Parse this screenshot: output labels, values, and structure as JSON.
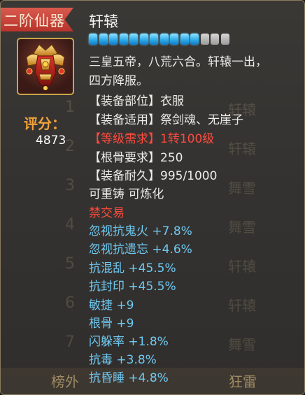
{
  "header": {
    "rank_tag": "二阶仙器",
    "item_name": "轩辕"
  },
  "gems": {
    "filled": 11,
    "total": 14
  },
  "icon": {
    "name": "armor-icon"
  },
  "score": {
    "label": "评分：",
    "value": "4873"
  },
  "details": {
    "desc_1": "三皇五帝，八荒六合。轩辕一出，",
    "desc_2": "四方降服。",
    "slot": "【装备部位】衣服",
    "applicable": "【装备适用】祭剑魂、无崖子",
    "level_req": "【等级需求】1转100级",
    "bone_req": "【根骨要求】250",
    "durability": "【装备耐久】995/1000",
    "flags": "可重铸 可炼化",
    "no_trade": "禁交易"
  },
  "attributes": [
    "忽视抗鬼火 +7.8%",
    "忽视抗遗忘 +4.6%",
    "抗混乱 +45.5%",
    "抗封印 +45.5%",
    "敏捷 +9",
    "根骨 +9",
    "闪躲率 +1.8%",
    "抗毒 +3.8%",
    "抗昏睡 +4.8%"
  ],
  "colors": {
    "red": "#ff4a3e",
    "blue": "#6fc9f2",
    "gold": "#f2a23a",
    "tag": "#c53d33"
  }
}
